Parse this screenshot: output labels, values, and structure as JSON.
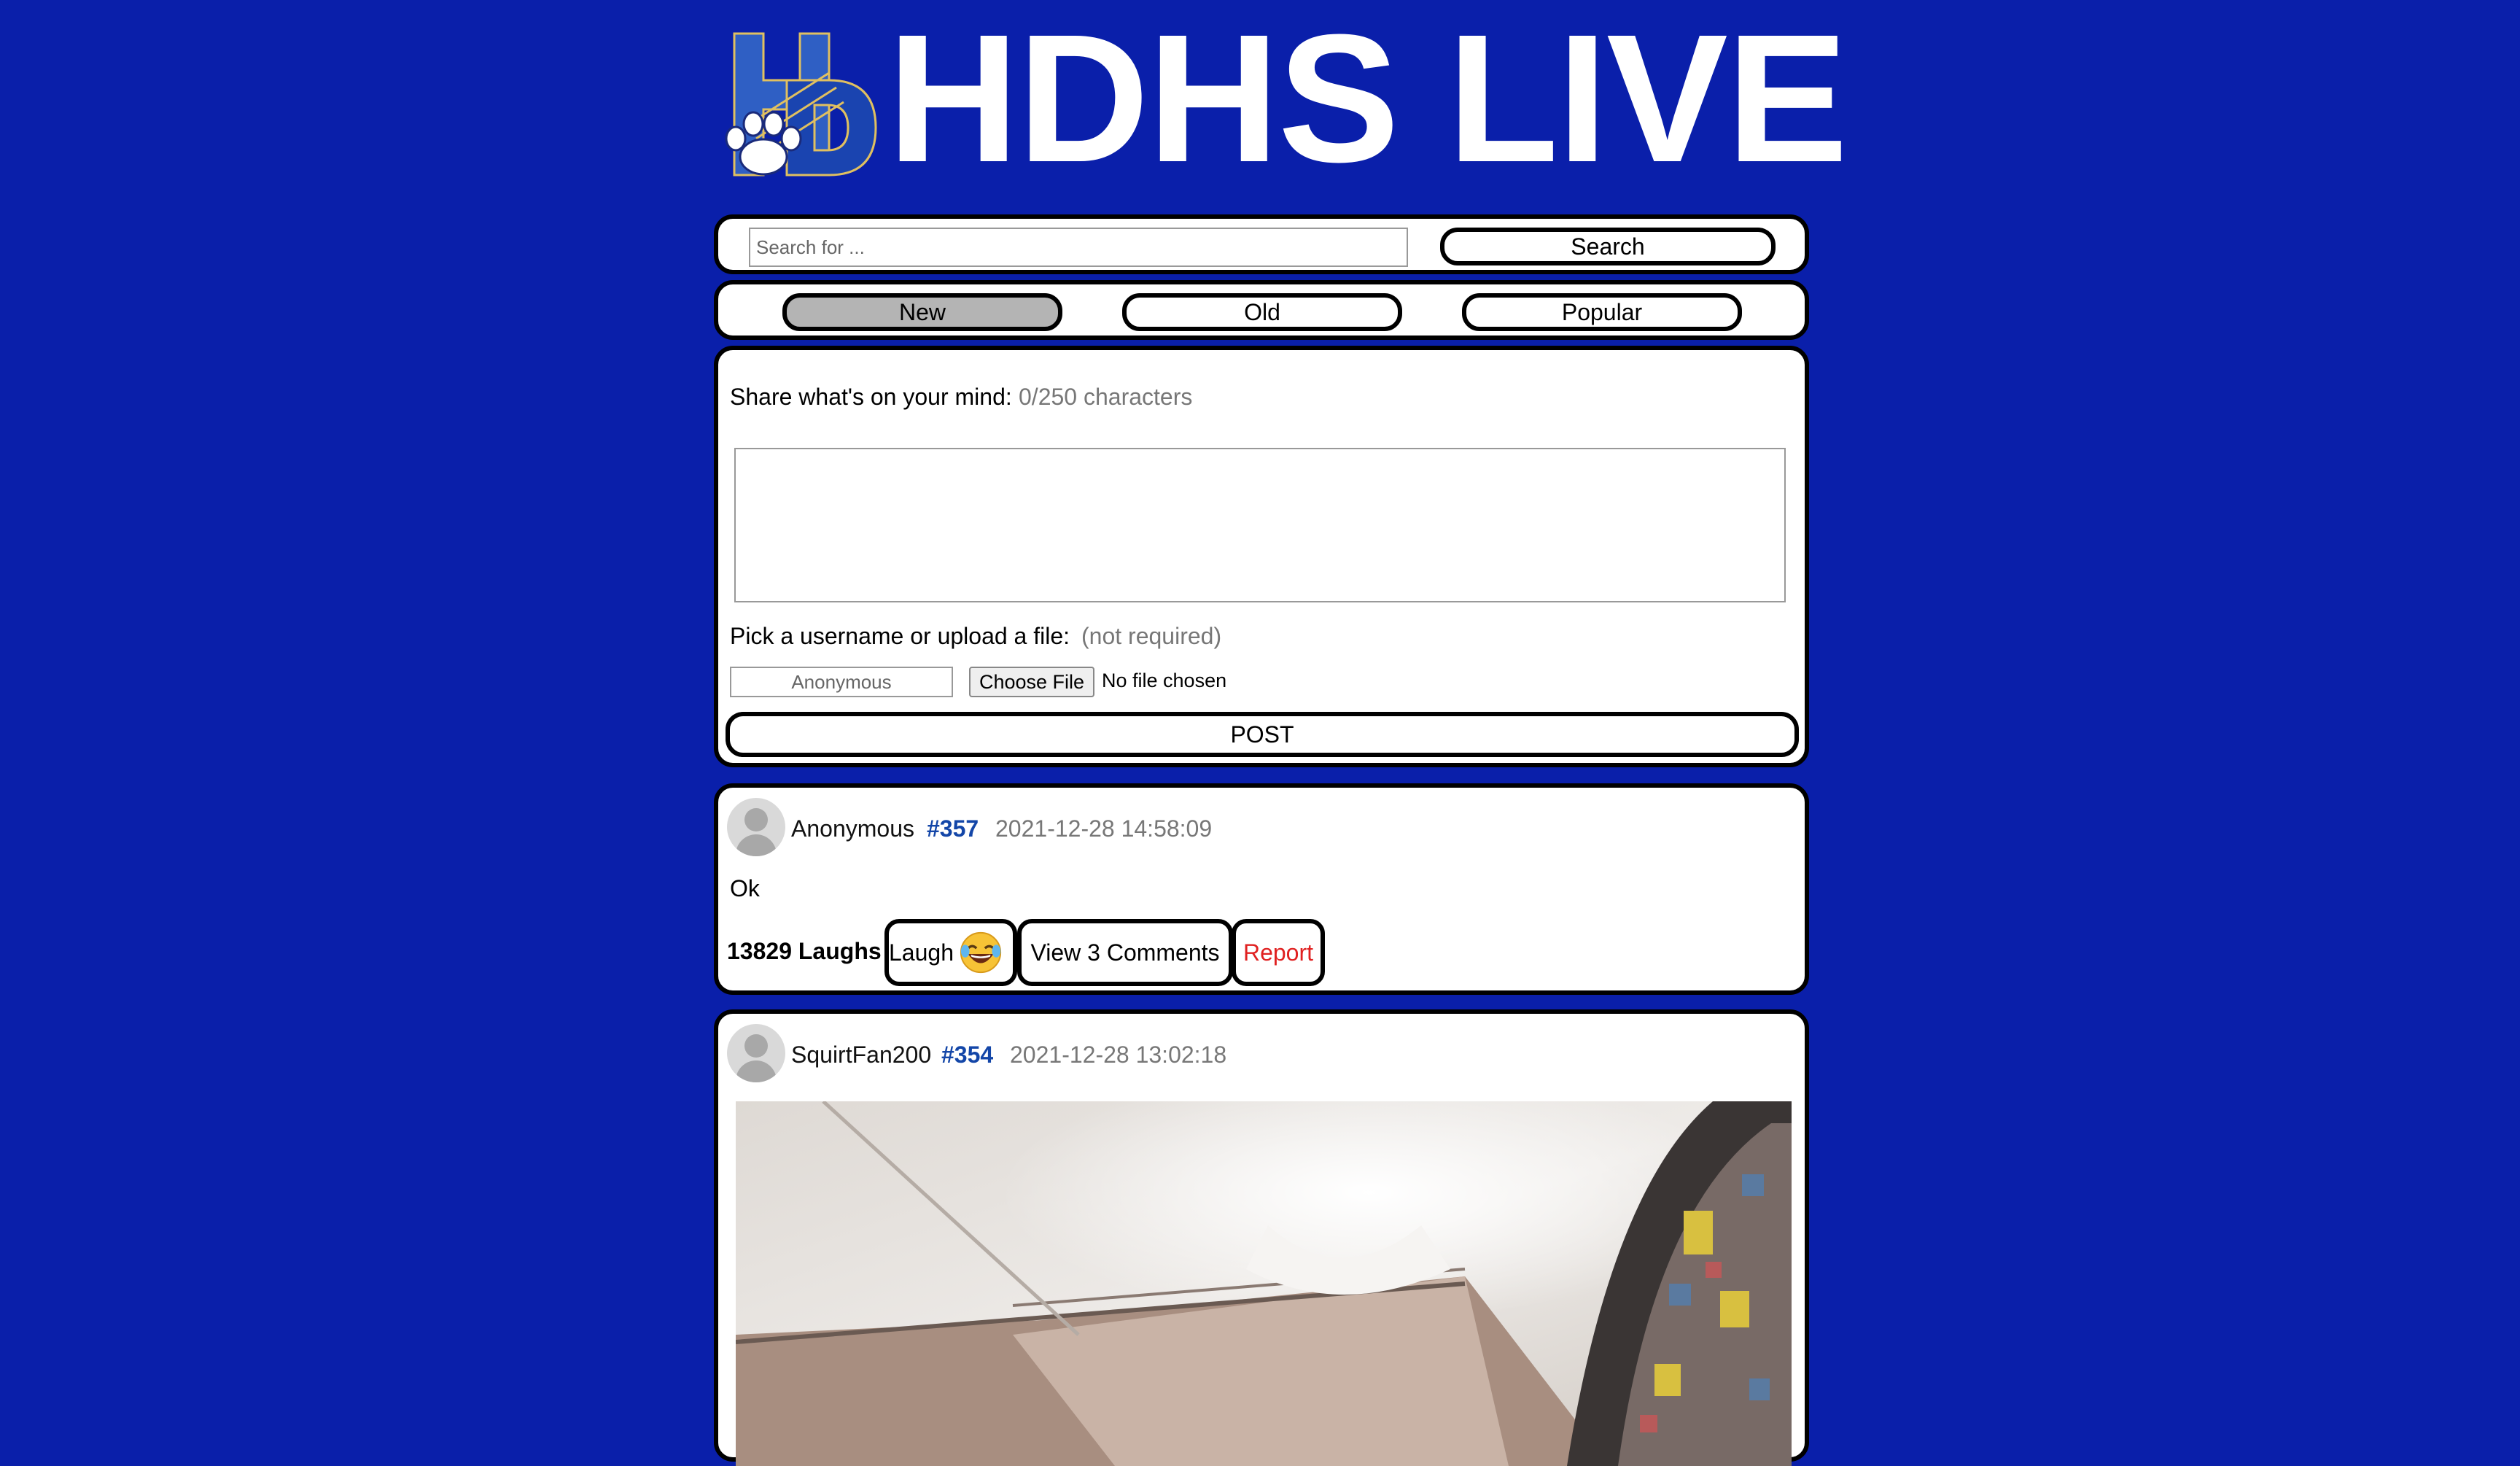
{
  "header": {
    "site_title": "HDHS LIVE"
  },
  "search": {
    "placeholder": "Search for ...",
    "button_label": "Search"
  },
  "sort_tabs": [
    {
      "label": "New",
      "active": true
    },
    {
      "label": "Old",
      "active": false
    },
    {
      "label": "Popular",
      "active": false
    }
  ],
  "composer": {
    "prompt_label": "Share what's on your mind:",
    "char_count": "0/250 characters",
    "username_label": "Pick a username or upload a file:",
    "optional_note": "(not required)",
    "username_placeholder": "Anonymous",
    "file_button_label": "Choose File",
    "file_status": "No file chosen",
    "post_button_label": "POST"
  },
  "posts": [
    {
      "username": "Anonymous",
      "post_number": "#357",
      "timestamp": "2021-12-28 14:58:09",
      "body": "Ok",
      "laughs_text": "13829 Laughs",
      "laugh_button_label": "Laugh",
      "comments_button_label": "View 3 Comments",
      "report_button_label": "Report"
    },
    {
      "username": "SquirtFan200",
      "post_number": "#354",
      "timestamp": "2021-12-28 13:02:18"
    }
  ],
  "colors": {
    "background": "#0a1faa",
    "post_number": "#1346a8",
    "report": "#e02020",
    "active_tab": "#b4b4b4"
  },
  "icons": [
    "hdhs-logo-icon",
    "default-avatar-icon",
    "laughing-emoji-icon"
  ]
}
